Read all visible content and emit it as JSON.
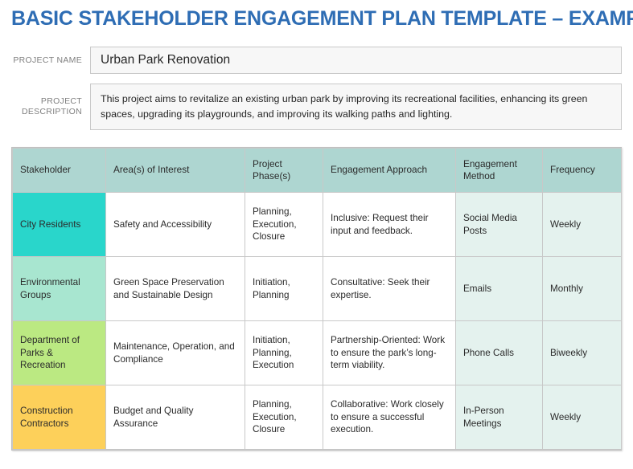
{
  "title": "Basic Stakeholder Engagement Plan Template – Example",
  "colors": {
    "title": "#2e6db4",
    "header_row": "#aed6d1",
    "method_tint": "#e4f2ee",
    "stakeholder_1": "#29d6cb",
    "stakeholder_2": "#a8e6d0",
    "stakeholder_3": "#bbe982",
    "stakeholder_4": "#fdd05a"
  },
  "form": {
    "project_name": {
      "label": "Project Name",
      "value": "Urban Park Renovation"
    },
    "project_description": {
      "label": "Project Description",
      "value": "This project aims to revitalize an existing urban park by improving its recreational facilities, enhancing its green spaces, upgrading its playgrounds, and improving its walking paths and lighting."
    }
  },
  "table": {
    "headers": [
      "Stakeholder",
      "Area(s) of Interest",
      "Project Phase(s)",
      "Engagement Approach",
      "Engagement Method",
      "Frequency"
    ],
    "rows": [
      {
        "stakeholder": "City Residents",
        "stakeholder_color": "#29d6cb",
        "area_of_interest": "Safety and Accessibility",
        "project_phases": "Planning, Execution, Closure",
        "engagement_approach": "Inclusive: Request their input and feedback.",
        "engagement_method": "Social Media Posts",
        "frequency": "Weekly"
      },
      {
        "stakeholder": "Environmental Groups",
        "stakeholder_color": "#a8e6d0",
        "area_of_interest": "Green Space Preservation and Sustainable Design",
        "project_phases": "Initiation, Planning",
        "engagement_approach": "Consultative: Seek their expertise.",
        "engagement_method": "Emails",
        "frequency": "Monthly"
      },
      {
        "stakeholder": "Department of Parks & Recreation",
        "stakeholder_color": "#bbe982",
        "area_of_interest": "Maintenance, Operation, and Compliance",
        "project_phases": "Initiation, Planning, Execution",
        "engagement_approach": "Partnership-Oriented: Work to ensure the park’s long-term viability.",
        "engagement_method": "Phone Calls",
        "frequency": "Biweekly"
      },
      {
        "stakeholder": "Construction Contractors",
        "stakeholder_color": "#fdd05a",
        "area_of_interest": "Budget and Quality Assurance",
        "project_phases": "Planning, Execution, Closure",
        "engagement_approach": "Collaborative: Work closely to ensure a successful execution.",
        "engagement_method": "In-Person Meetings",
        "frequency": "Weekly"
      }
    ]
  }
}
